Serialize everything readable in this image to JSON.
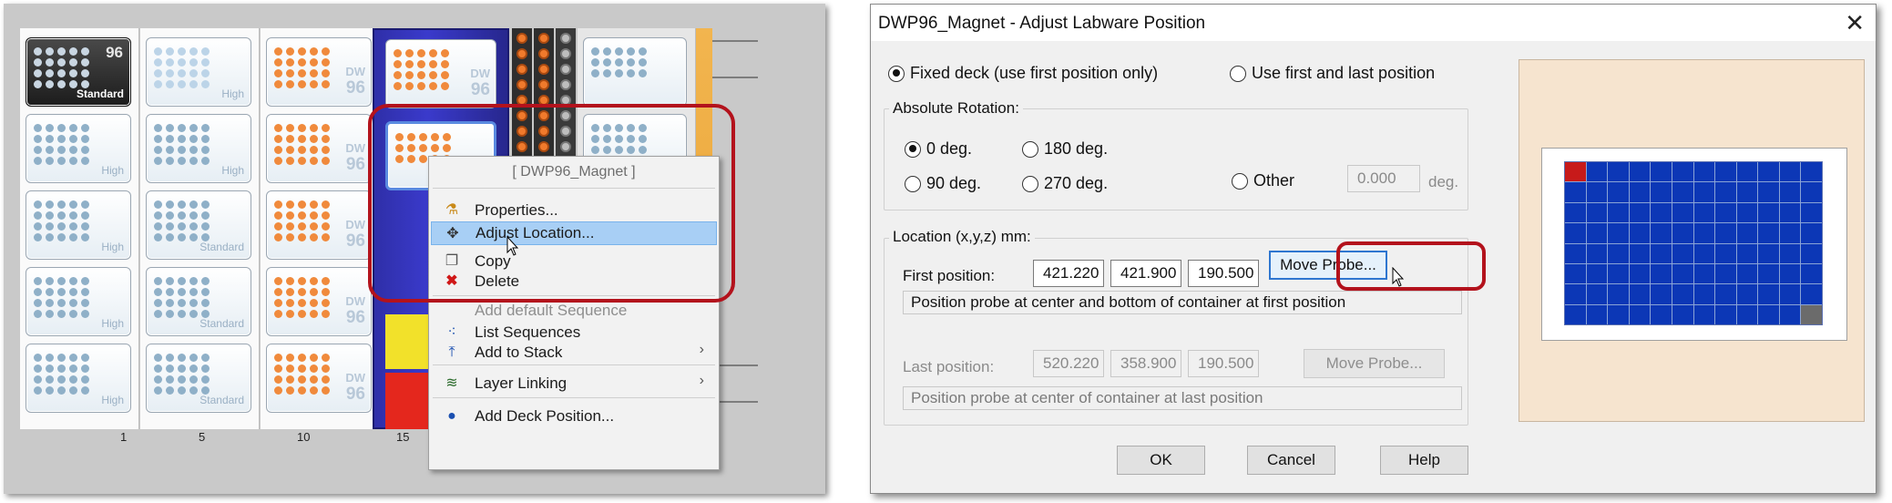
{
  "deck": {
    "numbers": [
      "1",
      "5",
      "10",
      "15"
    ],
    "top_plate": {
      "big": "96",
      "label": "Standard"
    },
    "plate_labels": {
      "high": "High",
      "standard": "Standard",
      "dw": "DW",
      "dw_num": "96"
    }
  },
  "context_menu": {
    "title": "[ DWP96_Magnet ]",
    "items": [
      {
        "label": "Properties...",
        "icon": "flask-icon",
        "state": "normal"
      },
      {
        "label": "Adjust Location...",
        "icon": "move-arrows-icon",
        "state": "active"
      },
      {
        "label": "Copy",
        "icon": "copy-icon",
        "state": "normal"
      },
      {
        "label": "Delete",
        "icon": "delete-x-icon",
        "state": "normal"
      },
      {
        "label": "Add default Sequence",
        "icon": "",
        "state": "disabled"
      },
      {
        "label": "List Sequences",
        "icon": "dots-icon",
        "state": "normal"
      },
      {
        "label": "Add to Stack",
        "icon": "stack-icon",
        "state": "submenu"
      },
      {
        "label": "Layer Linking",
        "icon": "layer-link-icon",
        "state": "submenu"
      },
      {
        "label": "Add Deck Position...",
        "icon": "circle-icon",
        "state": "normal"
      }
    ]
  },
  "dialog": {
    "title": "DWP96_Magnet - Adjust Labware Position",
    "close_glyph": "✕",
    "mode": {
      "fixed_label": "Fixed deck (use first position only)",
      "first_last_label": "Use first and last position",
      "selected": "fixed"
    },
    "rotation": {
      "group_label": "Absolute Rotation:",
      "options": [
        "0 deg.",
        "180 deg.",
        "90 deg.",
        "270 deg.",
        "Other"
      ],
      "selected": "0 deg.",
      "other_value": "0.000",
      "other_unit": "deg."
    },
    "location": {
      "group_label": "Location (x,y,z) mm:",
      "first_label": "First position:",
      "first": [
        "421.220",
        "421.900",
        "190.500"
      ],
      "first_button": "Move Probe...",
      "first_hint": "Position probe at center and bottom of container at first position",
      "last_label": "Last position:",
      "last": [
        "520.220",
        "358.900",
        "190.500"
      ],
      "last_button": "Move Probe...",
      "last_hint": "Position probe at center of container at last position"
    },
    "buttons": {
      "ok": "OK",
      "cancel": "Cancel",
      "help": "Help"
    },
    "preview": {
      "rows": 8,
      "cols": 12,
      "first_color": "#c71a1a",
      "well_color": "#0c37b6",
      "last_color": "#6b6b6b"
    }
  }
}
